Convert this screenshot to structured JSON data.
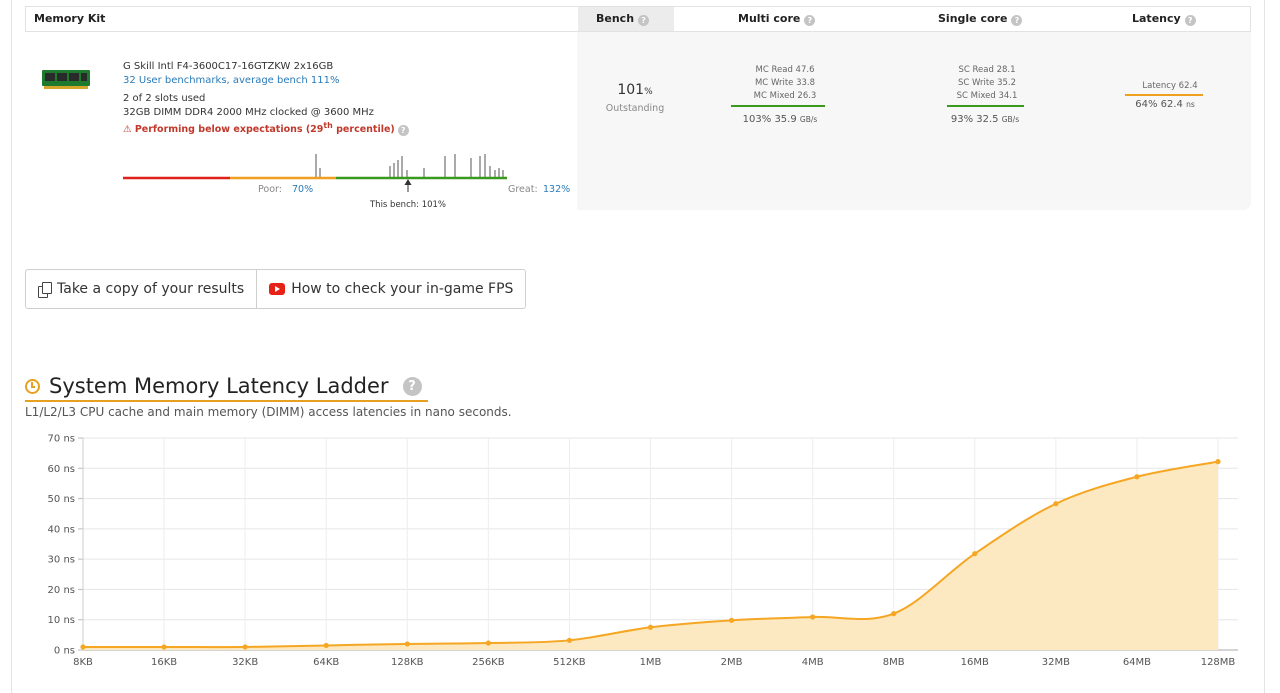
{
  "table": {
    "headers": {
      "kit": "Memory Kit",
      "bench": "Bench",
      "multi": "Multi core",
      "single": "Single core",
      "latency": "Latency"
    },
    "kit": {
      "name": "G Skill Intl F4-3600C17-16GTZKW 2x16GB",
      "benchmarks_link": "32 User benchmarks, average bench 111%",
      "slots": "2 of 2 slots used",
      "dimm": "32GB DIMM DDR4 2000 MHz clocked @ 3600 MHz",
      "warning_pre": "⚠ Performing below expectations (29",
      "warning_sup": "th",
      "warning_post": " percentile)",
      "poor_label": "Poor:",
      "poor_value": "70%",
      "great_label": "Great:",
      "great_value": "132%",
      "this_bench": "This bench: 101%"
    },
    "bench": {
      "value": "101",
      "unit": "%",
      "rating": "Outstanding"
    },
    "multi": {
      "read": "MC Read 47.6",
      "write": "MC Write 33.8",
      "mixed": "MC Mixed 26.3",
      "pct": "103% 35.9",
      "unit": "GB/s"
    },
    "single": {
      "read": "SC Read 28.1",
      "write": "SC Write 35.2",
      "mixed": "SC Mixed 34.1",
      "pct": "93% 32.5",
      "unit": "GB/s"
    },
    "latency": {
      "label": "Latency 62.4",
      "pct": "64% 62.4",
      "unit": "ns"
    },
    "colors": {
      "poor": "#e0201a",
      "mid": "#f0a020",
      "good": "#3a9a1e",
      "link": "#2a7ab8",
      "warn": "#c0392b"
    }
  },
  "buttons": {
    "copy": "Take a copy of your results",
    "fps": "How to check your in-game FPS"
  },
  "section": {
    "title": "System Memory Latency Ladder",
    "description": "L1/L2/L3 CPU cache and main memory (DIMM) access latencies in nano seconds."
  },
  "chart_data": {
    "type": "area",
    "x": [
      "8KB",
      "16KB",
      "32KB",
      "64KB",
      "128KB",
      "256KB",
      "512KB",
      "1MB",
      "2MB",
      "4MB",
      "8MB",
      "16MB",
      "32MB",
      "64MB",
      "128MB"
    ],
    "values": [
      1.0,
      1.0,
      1.0,
      1.5,
      2.0,
      2.3,
      3.2,
      7.5,
      9.8,
      10.9,
      12.0,
      31.8,
      48.3,
      57.2,
      62.2
    ],
    "y_ticks": [
      "0 ns",
      "10 ns",
      "20 ns",
      "30 ns",
      "40 ns",
      "50 ns",
      "60 ns",
      "70 ns"
    ],
    "ylim": [
      0,
      70
    ],
    "grid": true,
    "line_color": "#f5a623",
    "fill_color": "#fde9c1"
  }
}
